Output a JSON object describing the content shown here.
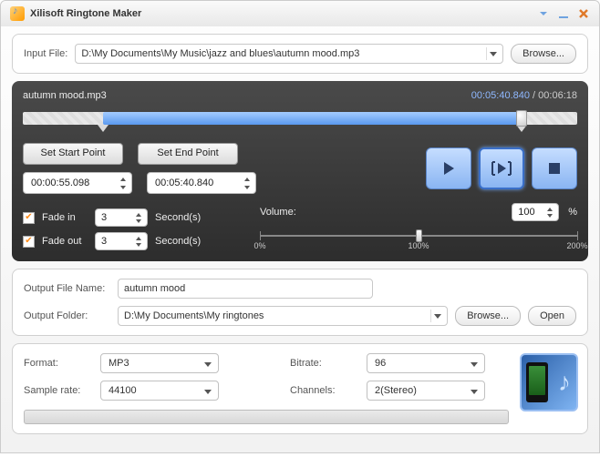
{
  "title": "Xilisoft Ringtone Maker",
  "input": {
    "label": "Input File:",
    "path": "D:\\My Documents\\My Music\\jazz and blues\\autumn mood.mp3",
    "browse": "Browse..."
  },
  "player": {
    "filename": "autumn mood.mp3",
    "current_time": "00:05:40.840",
    "total_time": "00:06:18",
    "sel_start_pct": 14.5,
    "sel_end_pct": 90.0,
    "pos_pct": 90.0,
    "set_start": "Set Start Point",
    "set_end": "Set End Point",
    "start_time": "00:00:55.098",
    "end_time": "00:05:40.840"
  },
  "fade": {
    "in_label": "Fade in",
    "in_checked": true,
    "in_value": "3",
    "out_label": "Fade out",
    "out_checked": true,
    "out_value": "3",
    "unit": "Second(s)"
  },
  "volume": {
    "label": "Volume:",
    "value": "100",
    "unit": "%",
    "ticks": [
      "0%",
      "100%",
      "200%"
    ],
    "pos_pct": 50
  },
  "output": {
    "name_label": "Output File Name:",
    "name": "autumn mood",
    "folder_label": "Output Folder:",
    "folder": "D:\\My Documents\\My ringtones",
    "browse": "Browse...",
    "open": "Open"
  },
  "settings": {
    "format_label": "Format:",
    "format": "MP3",
    "bitrate_label": "Bitrate:",
    "bitrate": "96",
    "samplerate_label": "Sample rate:",
    "samplerate": "44100",
    "channels_label": "Channels:",
    "channels": "2(Stereo)"
  }
}
